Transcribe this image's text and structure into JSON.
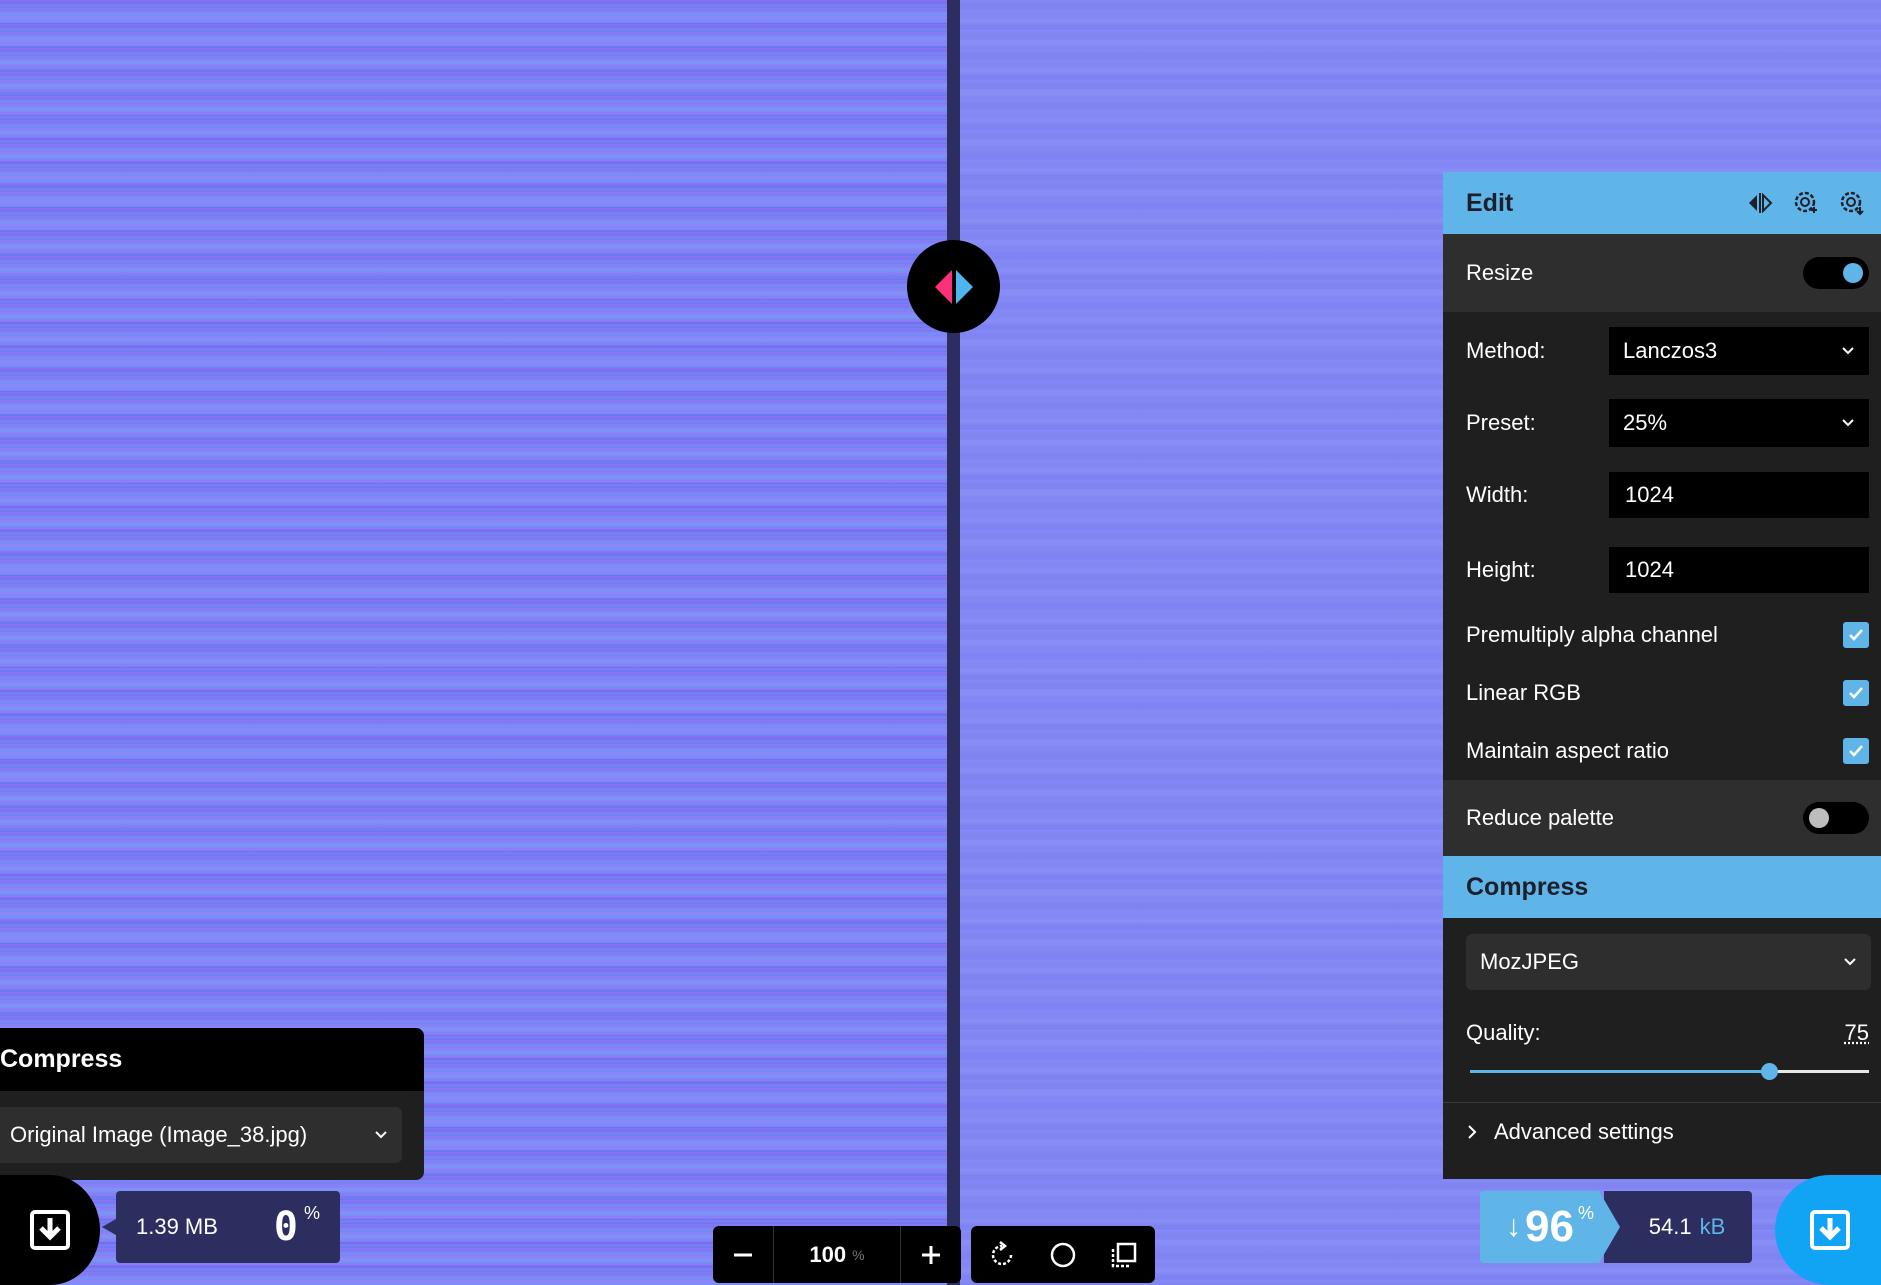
{
  "edit_panel": {
    "title": "Edit",
    "resize": {
      "label": "Resize",
      "enabled": true
    },
    "method": {
      "label": "Method:",
      "value": "Lanczos3"
    },
    "preset": {
      "label": "Preset:",
      "value": "25%"
    },
    "width": {
      "label": "Width:",
      "value": "1024"
    },
    "height": {
      "label": "Height:",
      "value": "1024"
    },
    "checks": [
      {
        "label": "Premultiply alpha channel",
        "checked": true
      },
      {
        "label": "Linear RGB",
        "checked": true
      },
      {
        "label": "Maintain aspect ratio",
        "checked": true
      }
    ],
    "reduce_palette": {
      "label": "Reduce palette",
      "enabled": false
    }
  },
  "compress_panel": {
    "title": "Compress",
    "codec": "MozJPEG",
    "quality_label": "Quality:",
    "quality_value": "75",
    "quality_fraction": 0.75,
    "advanced_label": "Advanced settings"
  },
  "left_panel": {
    "title": "Compress",
    "source": "Original Image (Image_38.jpg)",
    "size": "1.39 MB",
    "percent": "0",
    "percent_sign": "%"
  },
  "right_stats": {
    "arrow": "↓",
    "saving": "96",
    "percent_sign": "%",
    "size": "54.1",
    "unit": "kB"
  },
  "zoom": {
    "value": "100",
    "unit": "%"
  },
  "colors": {
    "accent": "#5fb5e8",
    "left_handle": "#ff2f7a",
    "right_handle": "#4fb5ee",
    "panel_bg": "#1f1f1f"
  }
}
